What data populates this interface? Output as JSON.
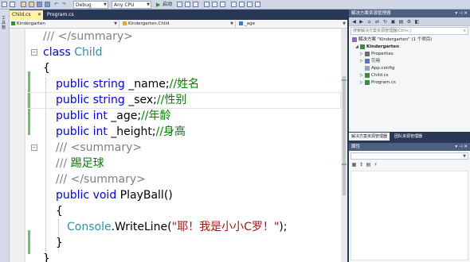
{
  "colors": {
    "keyword": "#0000ff",
    "comment": "#008000",
    "doc_tag": "#808080",
    "type": "#2b91af",
    "string": "#a31515",
    "panel_title": "#4d6082",
    "ide_background": "#293955",
    "active_tab": "#fff1a8",
    "change_bar": "#6cc06c"
  },
  "toolbar": {
    "config": "Debug",
    "platform": "Any CPU",
    "start_label": "启动",
    "icons": [
      "back-icon",
      "forward-icon",
      "new-project-icon",
      "open-icon",
      "save-icon",
      "save-all-icon",
      "undo-icon",
      "redo-icon",
      "start-icon"
    ]
  },
  "left_strip": {
    "label": "工具箱"
  },
  "tabs": [
    {
      "label": "Child.cs",
      "active": true
    },
    {
      "label": "Program.cs",
      "active": false
    }
  ],
  "navbar": {
    "project": "Kindergarten",
    "class": "Kindergarten.Child",
    "member": "_age"
  },
  "code": {
    "line1": {
      "slash": "/// ",
      "tag": "</summary>"
    },
    "line2": {
      "kw": "class",
      "name": " Child"
    },
    "line3": {
      "text": "{"
    },
    "line4": {
      "kw1": "public",
      "kw2": " string",
      "name": " _name;",
      "comment": "//姓名"
    },
    "line5": {
      "kw1": "public",
      "kw2": " string",
      "name": " _sex;",
      "comment": "//性别"
    },
    "line6": {
      "kw1": "public",
      "kw2": " int",
      "name": " _age;",
      "comment": "//年龄"
    },
    "line7": {
      "kw1": "public",
      "kw2": " int",
      "name": " _height;",
      "comment": "//身高"
    },
    "line8": {
      "slash": "/// ",
      "tag": "<summary>"
    },
    "line9": {
      "slash": "/// ",
      "text": "踢足球"
    },
    "line10": {
      "slash": "/// ",
      "tag": "</summary>"
    },
    "line11": {
      "kw1": "public",
      "kw2": " void",
      "name": " PlayBall()"
    },
    "line12": {
      "text": "{"
    },
    "line13": {
      "type": "Console",
      "method": ".WriteLine(",
      "str": "\"耶！我是小小C罗！\"",
      "end": ");"
    },
    "line14": {
      "text": "}"
    },
    "line15": {
      "text": "}"
    }
  },
  "solution_explorer": {
    "title": "解决方案资源管理器",
    "search_placeholder": "搜索解决方案资源管理器(Ctrl+;)",
    "items": [
      {
        "label": "解决方案 \"Kindergarten\" (1 个项目)",
        "icon": "solution-icon"
      },
      {
        "label": "Kindergarten",
        "icon": "csharp-project-icon",
        "bold": true
      },
      {
        "label": "Properties",
        "icon": "wrench-icon"
      },
      {
        "label": "引用",
        "icon": "references-icon"
      },
      {
        "label": "App.config",
        "icon": "config-file-icon"
      },
      {
        "label": "Child.cs",
        "icon": "csharp-file-icon"
      },
      {
        "label": "Program.cs",
        "icon": "csharp-file-icon"
      }
    ],
    "bottom_tabs": [
      "解决方案资源管理器",
      "团队资源管理器"
    ]
  },
  "properties": {
    "title": "属性"
  }
}
